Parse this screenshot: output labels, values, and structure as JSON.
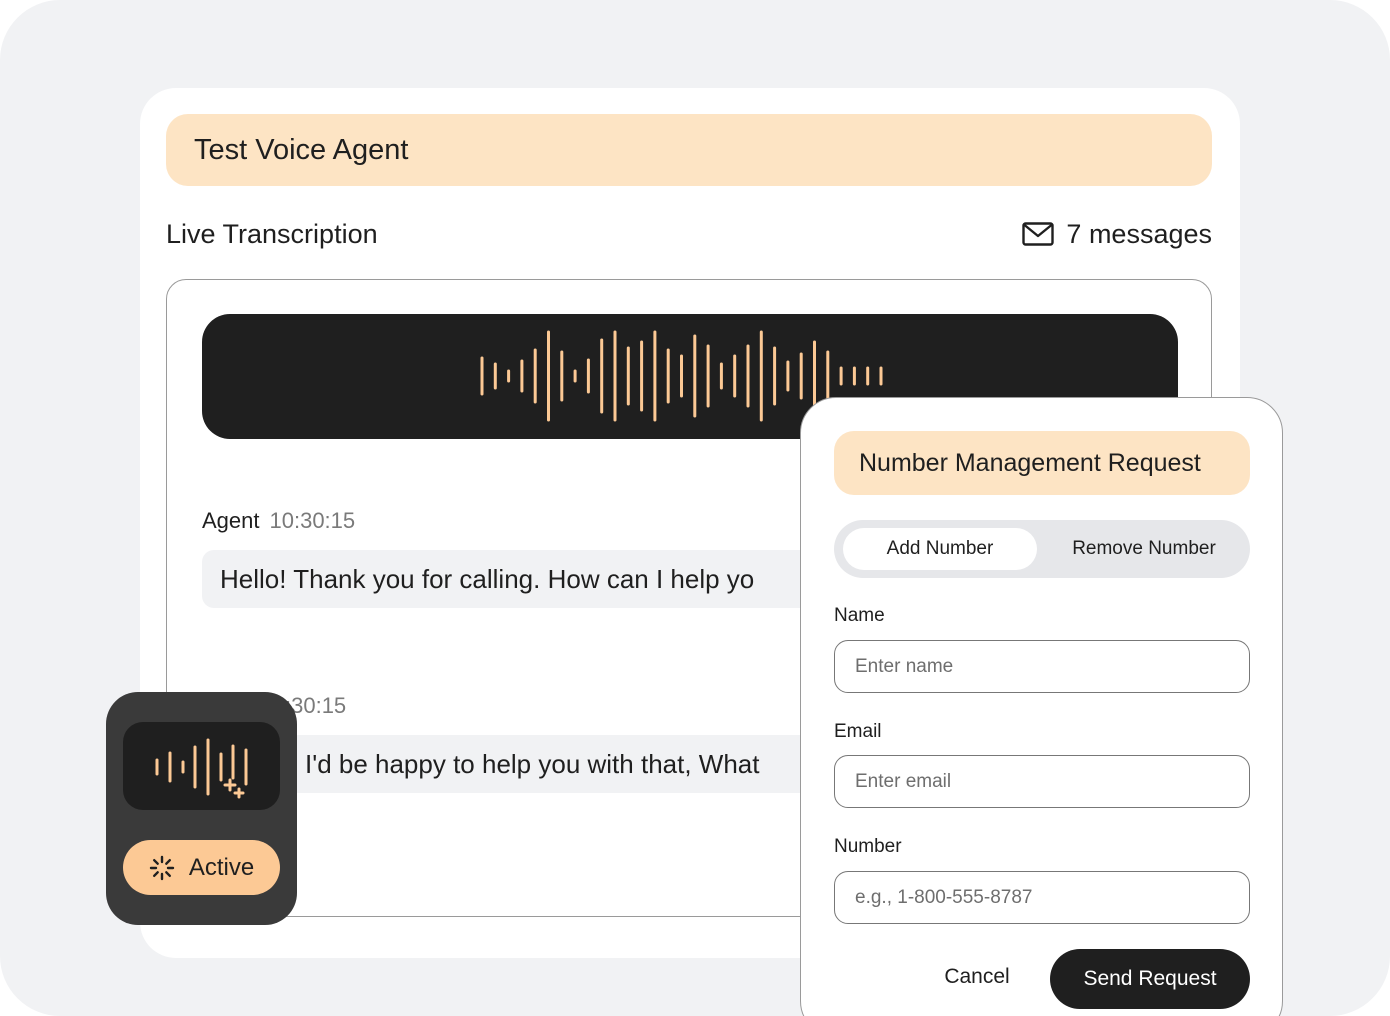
{
  "colors": {
    "background": "#f1f2f4",
    "card": "#ffffff",
    "accent_soft": "#fde4c4",
    "accent": "#fcc995",
    "wave": "#fcc995",
    "dark": "#1f1f1f",
    "widget": "#3a3a3a"
  },
  "agent": {
    "title": "Test Voice Agent"
  },
  "transcription": {
    "title": "Live Transcription",
    "message_count_label": "7 messages",
    "message_count_icon": "mail-icon",
    "messages": [
      {
        "speaker": "Agent",
        "time": "10:30:15",
        "text": "Hello! Thank you for calling. How can I help yo"
      },
      {
        "speaker": "",
        "time": ":30:15",
        "text": "I'd be happy to help you with that, What"
      }
    ]
  },
  "status_widget": {
    "icon": "voice-wave-sparkle-icon",
    "status_icon": "loading-spinner-icon",
    "status_label": "Active"
  },
  "request_form": {
    "title": "Number Management Request",
    "tabs": [
      {
        "label": "Add Number",
        "selected": true
      },
      {
        "label": "Remove Number",
        "selected": false
      }
    ],
    "fields": {
      "name": {
        "label": "Name",
        "placeholder": "Enter name",
        "value": ""
      },
      "email": {
        "label": "Email",
        "placeholder": "Enter email",
        "value": ""
      },
      "number": {
        "label": "Number",
        "placeholder": "e.g., 1-800-555-8787",
        "value": ""
      }
    },
    "cancel_label": "Cancel",
    "submit_label": "Send Request"
  }
}
